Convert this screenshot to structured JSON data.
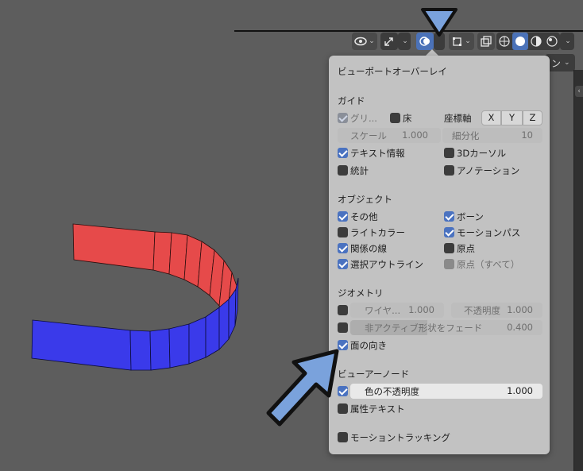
{
  "header": {
    "partial_right_label": "ン",
    "icons": [
      "visibility-icon",
      "gizmo-icon",
      "overlay-icon",
      "xray-icon",
      "wireframe-shading-icon",
      "solid-shading-icon",
      "material-shading-icon",
      "rendered-shading-icon"
    ]
  },
  "panel": {
    "title": "ビューポートオーバーレイ",
    "guides": {
      "heading": "ガイド",
      "grid_label": "グリ...",
      "floor_label": "床",
      "axes_label": "座標軸",
      "axis_x": "X",
      "axis_y": "Y",
      "axis_z": "Z",
      "scale_label": "スケール",
      "scale_value": "1.000",
      "subdiv_label": "細分化",
      "subdiv_value": "10",
      "text_info_label": "テキスト情報",
      "cursor_3d_label": "3Dカーソル",
      "stats_label": "統計",
      "annotation_label": "アノテーション"
    },
    "objects": {
      "heading": "オブジェクト",
      "extras_label": "その他",
      "bones_label": "ボーン",
      "light_colors_label": "ライトカラー",
      "motion_paths_label": "モーションパス",
      "relations_label": "関係の線",
      "origins_label": "原点",
      "outline_label": "選択アウトライン",
      "origins_all_label": "原点（すべて）"
    },
    "geometry": {
      "heading": "ジオメトリ",
      "wireframe_label": "ワイヤ...",
      "wireframe_value": "1.000",
      "opacity_label": "不透明度",
      "opacity_value": "1.000",
      "fade_label": "非アクティブ形状をフェード",
      "fade_value": "0.400",
      "face_orientation_label": "面の向き"
    },
    "viewer_node": {
      "heading": "ビューアーノード",
      "color_opacity_label": "色の不透明度",
      "color_opacity_value": "1.000",
      "attribute_text_label": "属性テキスト"
    },
    "motion_tracking_label": "モーショントラッキング"
  },
  "checkbox_states": {
    "grid": "dim-checked",
    "floor": false,
    "text_info": true,
    "cursor_3d": false,
    "stats": false,
    "annotation": false,
    "extras": true,
    "bones": true,
    "light_colors": false,
    "motion_paths": true,
    "relations": true,
    "origins": false,
    "outline": true,
    "origins_all": "disabled",
    "wireframe": false,
    "fade": false,
    "face_orientation": true,
    "color_opacity": true,
    "attribute_text": false,
    "motion_tracking": false
  },
  "colors": {
    "viewport_bg": "#5d5d5d",
    "panel_bg": "#c2c2c2",
    "accent": "#4a72c0",
    "face_front": "#3d3de6",
    "face_back": "#e84a4a",
    "callout_arrow": "#7aa2dc"
  }
}
